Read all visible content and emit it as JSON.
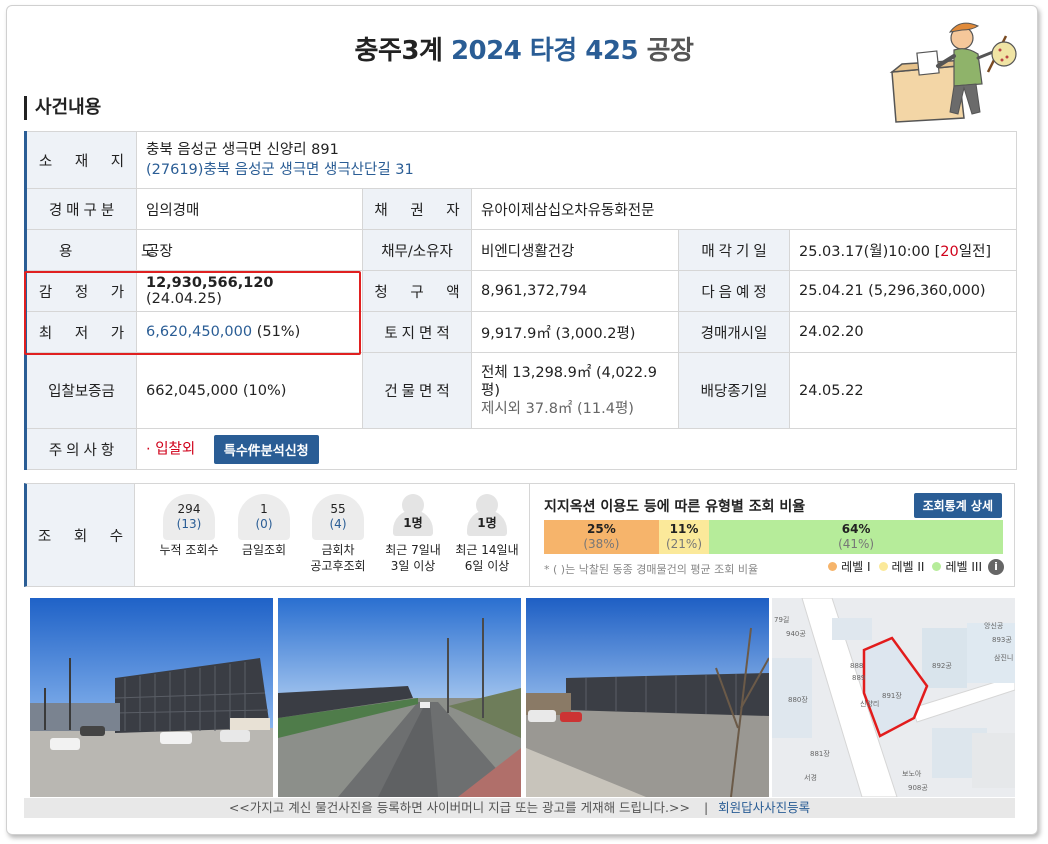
{
  "title": {
    "court": "충주3계",
    "case": "2024 타경 425",
    "kind": "공장"
  },
  "section_title": "사건내용",
  "info": {
    "address_label": "소 재 지",
    "address_line1": "충북 음성군 생극면 신양리 891",
    "address_line2": "(27619)충북 음성군  생극면 생극산단길  31",
    "auction_type_label": "경매구분",
    "auction_type": "임의경매",
    "creditor_label": "채 권 자",
    "creditor": "유아이제삼십오차유동화전문",
    "usage_label": "용 도",
    "usage": "공장",
    "debtor_label": "채무/소유자",
    "debtor": "비엔디생활건강",
    "sale_date_label": "매각기일",
    "sale_date": "25.03.17(월)10:00 [",
    "sale_days": "20",
    "sale_date_suffix": "일전]",
    "appraisal_label": "감 정 가",
    "appraisal_value": "12,930,566,120",
    "appraisal_date": " (24.04.25)",
    "claim_label": "청 구 액",
    "claim": "8,961,372,794",
    "next_label": "다음예정",
    "next": "25.04.21 (5,296,360,000)",
    "min_price_label": "최 저 가",
    "min_price": "6,620,450,000",
    "min_price_pct": " (51%)",
    "land_area_label": "토지면적",
    "land_area": "9,917.9㎡ (3,000.2평)",
    "start_date_label": "경매개시일",
    "start_date": "24.02.20",
    "deposit_label": "입찰보증금",
    "deposit": "662,045,000 (10%)",
    "building_area_label": "건물면적",
    "building_area_line1": "전체 13,298.9㎡ (4,022.9",
    "building_area_line2": "평)",
    "building_area_line3": "제시외 37.8㎡ (11.4평)",
    "dividend_label": "배당종기일",
    "dividend": "24.05.22",
    "notice_label": "주의사항",
    "notice": "· 입찰외",
    "special_button": "특수件분석신청"
  },
  "views": {
    "label": "조 회 수",
    "stats": [
      {
        "value": "294",
        "sub": "(13)",
        "caption1": "누적 조회수",
        "caption2": ""
      },
      {
        "value": "1",
        "sub": "(0)",
        "caption1": "금일조회",
        "caption2": ""
      },
      {
        "value": "55",
        "sub": "(4)",
        "caption1": "금회차",
        "caption2": "공고후조회"
      },
      {
        "value": "1명",
        "caption1": "최근 7일내",
        "caption2": "3일 이상"
      },
      {
        "value": "1명",
        "caption1": "최근 14일내",
        "caption2": "6일 이상"
      }
    ],
    "ratio_title": "지지옥션 이용도 등에 따른 유형별 조회 비율",
    "ratio_button": "조회통계 상세",
    "segments": [
      {
        "pct": "25%",
        "avg": "(38%)",
        "color": "#f6b46b"
      },
      {
        "pct": "11%",
        "avg": "(21%)",
        "color": "#fbe99a"
      },
      {
        "pct": "64%",
        "avg": "(41%)",
        "color": "#b6ec9a"
      }
    ],
    "note": "* ( )는 낙찰된 동종 경매물건의 평균 조회 비율",
    "legend": [
      {
        "label": "레벨 I",
        "color": "#f6b46b"
      },
      {
        "label": "레벨 II",
        "color": "#fbe99a"
      },
      {
        "label": "레벨 III",
        "color": "#b6ec9a"
      }
    ]
  },
  "map_labels": {
    "l1": "79길",
    "l2": "940공",
    "l3": "893공",
    "l4": "892공",
    "l5": "888",
    "l6": "889",
    "l7": "891장",
    "l8": "880장",
    "l9": "881장",
    "l10": "삼진니",
    "l11": "앙신공",
    "l12": "보노아",
    "l13": "908공",
    "l14": "서경",
    "l15": "신양리"
  },
  "footer": {
    "text": "<<가지고 계신 물건사진을 등록하면 사이버머니 지급 또는 광고를 게재해 드립니다.>>",
    "separator": "|",
    "register": "회원답사사진등록"
  }
}
